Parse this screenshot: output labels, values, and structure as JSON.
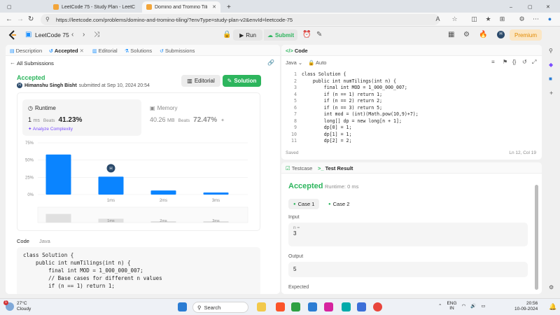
{
  "browser": {
    "tabs": [
      {
        "title": "LeetCode 75 - Study Plan - LeetC",
        "active": false
      },
      {
        "title": "Domino and Tromino Tiling - Leet",
        "active": true
      }
    ],
    "url": "https://leetcode.com/problems/domino-and-tromino-tiling/?envType=study-plan-v2&envId=leetcode-75"
  },
  "lcnav": {
    "title": "LeetCode 75",
    "run_label": "Run",
    "submit_label": "Submit",
    "premium_label": "Premium",
    "avatar": "H"
  },
  "left": {
    "tabs": [
      {
        "label": "Description"
      },
      {
        "label": "Accepted"
      },
      {
        "label": "Editorial"
      },
      {
        "label": "Solutions"
      },
      {
        "label": "Submissions"
      }
    ],
    "back_label": "All Submissions",
    "status": "Accepted",
    "author": "Himanshu Singh Bisht",
    "submitted": "submitted at Sep 10, 2024 20:54",
    "editorial_btn": "Editorial",
    "solution_btn": "Solution",
    "runtime": {
      "title": "Runtime",
      "value": "1",
      "unit": "ms",
      "beats_label": "Beats",
      "beats": "41.23%",
      "analyze": "Analyze Complexity"
    },
    "memory": {
      "title": "Memory",
      "value": "40.26",
      "unit": "MB",
      "beats_label": "Beats",
      "beats": "72.47%"
    },
    "code_label": "Code",
    "code_lang": "Java",
    "code_lines": [
      "class Solution {",
      "    public int numTilings(int n) {",
      "        final int MOD = 1_000_000_007;",
      "",
      "        // Base cases for different n values",
      "        if (n == 1) return 1;"
    ]
  },
  "chart_data": {
    "type": "bar",
    "title": "",
    "xlabel": "",
    "ylabel": "",
    "yticks": [
      "75%",
      "50%",
      "25%",
      "0%"
    ],
    "ylim": [
      0,
      75
    ],
    "categories": [
      "0ms",
      "1ms",
      "2ms",
      "3ms"
    ],
    "xtick_labels": [
      "",
      "1ms",
      "2ms",
      "3ms"
    ],
    "values": [
      58,
      26,
      6,
      3
    ],
    "highlight_index": 1,
    "marker_label": "H",
    "colors": {
      "bar": "#0a84ff",
      "mini": "#e0e0e0"
    },
    "grid": true,
    "legend": "none",
    "scrubber_labels": [
      "1ms",
      "2ms",
      "3ms"
    ]
  },
  "code": {
    "header": "Code",
    "lang": "Java",
    "mode": "Auto",
    "lines": [
      "class Solution {",
      "    public int numTilings(int n) {",
      "        final int MOD = 1_000_000_007;",
      "        if (n == 1) return 1;",
      "        if (n == 2) return 2;",
      "        if (n == 3) return 5;",
      "        int mod = (int)(Math.pow(10,9)+7);",
      "        long[] dp = new long[n + 1];",
      "        dp[0] = 1;",
      "        dp[1] = 1;",
      "        dp[2] = 2;"
    ],
    "line_numbers": [
      "1",
      "2",
      "3",
      "4",
      "5",
      "6",
      "7",
      "8",
      "9",
      "10",
      "11"
    ],
    "saved": "Saved",
    "cursor": "Ln 12, Col 19"
  },
  "result": {
    "tabs": [
      {
        "label": "Testcase"
      },
      {
        "label": "Test Result"
      }
    ],
    "status": "Accepted",
    "runtime": "Runtime: 0 ms",
    "cases": [
      {
        "label": "Case 1"
      },
      {
        "label": "Case 2"
      }
    ],
    "input_label": "Input",
    "input_var": "n =",
    "input_value": "3",
    "output_label": "Output",
    "output_value": "5",
    "expected_label": "Expected"
  },
  "taskbar": {
    "temp": "27°C",
    "weather": "Cloudy",
    "badge": "1",
    "search": "Search",
    "lang": "ENG",
    "region": "IN",
    "time": "20:56",
    "date": "10-09-2024"
  }
}
